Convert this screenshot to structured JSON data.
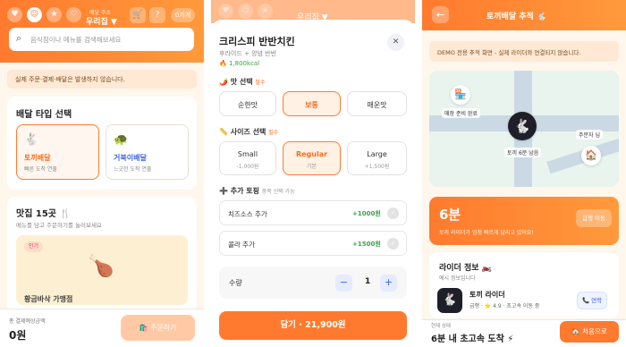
{
  "screen1": {
    "location_caption": "배달 주소",
    "location": "우리집 ▼",
    "header_buttons": {
      "cart": "🛒",
      "help": "?",
      "badge": "0가게"
    },
    "search_placeholder": "음식점이나 메뉴를 검색해보세요",
    "notice": "실제 주문·결제·배달은 발생하지 않습니다.",
    "delivery_type": {
      "title": "배달 타입 선택",
      "options": [
        {
          "emoji": "🐇",
          "name": "토끼배달",
          "desc": "빠른 도착 연출"
        },
        {
          "emoji": "🐢",
          "name": "거북이배달",
          "desc": "느긋한 도착 연출"
        }
      ]
    },
    "restaurants": {
      "title": "맛집 15곳 🍴",
      "subtitle": "메뉴를 담고 주문하기를 눌러보세요",
      "badge": "인기",
      "food_emoji": "🍗",
      "partial_name": "황금바삭 가맹점"
    },
    "bottom": {
      "total_label": "총 결제예상금액",
      "total": "0원",
      "order_button": "🛍️ 주문하기"
    }
  },
  "screen2": {
    "dim_location": "우리집 ▼",
    "item_title": "크리스피 반반치킨",
    "item_sub": "후라이드 + 양념 반반",
    "kcal": "🔥 1,800kcal",
    "close": "✕",
    "taste": {
      "title": "🌶️ 맛 선택",
      "req": "필수",
      "options": [
        "순한맛",
        "보통",
        "매운맛"
      ]
    },
    "size": {
      "title": "📏 사이즈 선택",
      "req": "필수",
      "options": [
        {
          "label": "Small",
          "sub": "-1,000원"
        },
        {
          "label": "Regular",
          "sub": "기본"
        },
        {
          "label": "Large",
          "sub": "+1,500원"
        }
      ]
    },
    "toppings": {
      "title": "➕ 추가 토핑",
      "opt": "중복 선택 가능",
      "items": [
        {
          "name": "치즈소스 추가",
          "price": "+1000원"
        },
        {
          "name": "콜라 추가",
          "price": "+1500원"
        }
      ]
    },
    "quantity": {
      "label": "수량",
      "minus": "−",
      "value": "1",
      "plus": "+"
    },
    "cta": "담기 · 21,900원"
  },
  "screen3": {
    "back": "←",
    "title": "토끼배달 추적 🐇",
    "demo_notice": "DEMO 전용 추적 화면 - 실제 라이더와 연결되지 않습니다.",
    "map": {
      "store_label": "매장 준비 완료",
      "rider_label": "토끼 6분 남음",
      "customer_label": "주문자 님"
    },
    "eta": {
      "value": "6분",
      "desc": "토끼 라이더가 엄청 빠르게 달리고 있어요!",
      "button": "급행 이동"
    },
    "rider": {
      "title": "라이더 정보 🏍️",
      "subtitle": "예시 정보입니다",
      "name": "토끼 라이더",
      "stats": "급행 · ⭐ 4.9 · 초고속 이동 중",
      "call": "📞 연락"
    },
    "bottom": {
      "status_label": "현재 상태",
      "status": "6분 내 초고속 도착 ⚡",
      "home_button": "🏠 처음으로"
    }
  }
}
